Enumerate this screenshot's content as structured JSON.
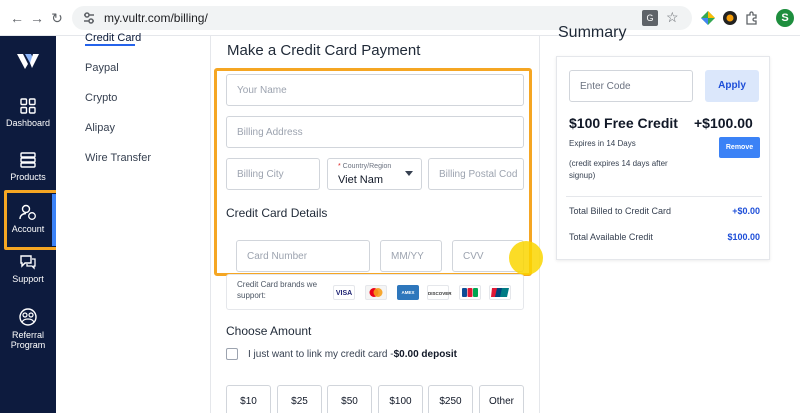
{
  "browser": {
    "url": "my.vultr.com/billing/",
    "profile_initial": "S",
    "icons": [
      "back-icon",
      "forward-icon",
      "reload-icon",
      "site-settings-icon",
      "translate-icon",
      "star-icon",
      "extension-icon",
      "puzzle-icon"
    ]
  },
  "rail": {
    "items": [
      {
        "label": "Dashboard",
        "icon": "dashboard-icon"
      },
      {
        "label": "Products",
        "icon": "products-icon"
      },
      {
        "label": "Account",
        "icon": "account-icon",
        "active": true
      },
      {
        "label": "Support",
        "icon": "support-icon"
      },
      {
        "label": "Referral",
        "label2": "Program",
        "icon": "referral-icon"
      }
    ]
  },
  "submenu": {
    "items": [
      "Credit Card",
      "Paypal",
      "Crypto",
      "Alipay",
      "Wire Transfer"
    ],
    "active": "Credit Card"
  },
  "form": {
    "title": "Make a Credit Card Payment",
    "name_placeholder": "Your Name",
    "address_placeholder": "Billing Address",
    "city_placeholder": "Billing City",
    "country_label": "Country/Region",
    "country_value": "Viet Nam",
    "postal_placeholder": "Billing Postal Cod",
    "card_details_title": "Credit Card Details",
    "card_number_placeholder": "Card Number",
    "expiry_placeholder": "MM/YY",
    "cvv_placeholder": "CVV",
    "brands_text": "Credit Card brands we support:",
    "brands": [
      "VISA",
      "MC",
      "AMEX",
      "DISCOVER",
      "JCB",
      "UnionPay"
    ],
    "choose_amount_title": "Choose Amount",
    "link_only_label": "I just want to link my credit card -",
    "link_only_amount": "$0.00 deposit",
    "amounts": [
      "$10",
      "$25",
      "$50",
      "$100",
      "$250",
      "Other"
    ]
  },
  "summary": {
    "title": "Summary",
    "code_placeholder": "Enter Code",
    "apply_label": "Apply",
    "credit_title": "$100 Free Credit",
    "credit_amount": "+$100.00",
    "expires": "Expires in 14 Days",
    "expires_note": "(credit expires 14 days after signup)",
    "remove_label": "Remove",
    "rows": [
      {
        "label": "Total Billed to Credit Card",
        "value": "+$0.00"
      },
      {
        "label": "Total Available Credit",
        "value": "$100.00"
      }
    ]
  },
  "colors": {
    "sidebar_bg": "#0d1b3e",
    "highlight": "#f5a623",
    "accent": "#2563eb"
  }
}
